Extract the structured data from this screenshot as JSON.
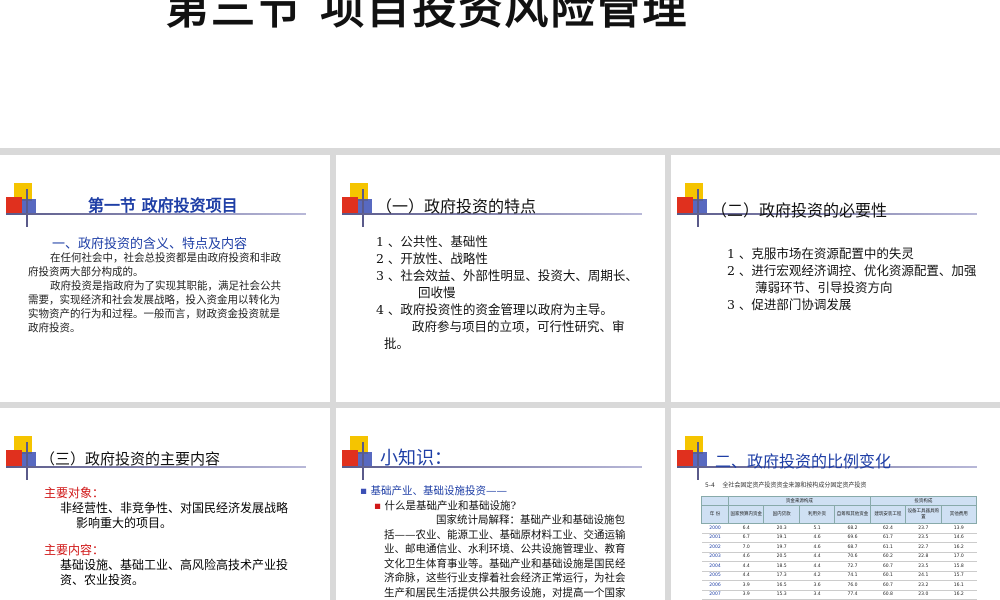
{
  "main_title": "第三节 项目投资风险管理",
  "slide1": {
    "title": "第一节 政府投资项目",
    "subtitle": "一、政府投资的含义、特点及内容",
    "para1": [
      "在任何社会中，社会总投资都是由政府投资和非政",
      "府投资两大部分构成的。"
    ],
    "para2": [
      "政府投资是指政府为了实现其职能，满足社会公共",
      "需要，实现经济和社会发展战略，投入资金用以转化为",
      "实物资产的行为和过程。一般而言，财政资金投资就是",
      "政府投资。"
    ]
  },
  "slide2": {
    "title": "（一）政府投资的特点",
    "items": [
      "1 、公共性、基础性",
      "2 、开放性、战略性",
      "3 、社会效益、外部性明显、投资大、周期长、",
      "回收慢",
      "4 、政府投资性的资金管理以政府为主导。",
      "政府参与项目的立项，可行性研究、审",
      "批。"
    ]
  },
  "slide3": {
    "title": "（二）政府投资的必要性",
    "items": [
      "1 、克服市场在资源配置中的失灵",
      "2 、进行宏观经济调控、优化资源配置、加强",
      "薄弱环节、引导投资方向",
      "3 、促进部门协调发展"
    ]
  },
  "slide4": {
    "title": "（三）政府投资的主要内容",
    "label1": "主要对象：",
    "text1": [
      "非经营性、非竞争性、对国民经济发展战略",
      "影响重大的项目。"
    ],
    "label2": "主要内容：",
    "text2": [
      "基础设施、基础工业、高风险高技术产业投",
      "资、农业投资。"
    ]
  },
  "slide5": {
    "title": "小知识：",
    "bullet1": "基础产业、基础设施投资——",
    "bullet2": "什么是基础产业和基础设施?",
    "lines": [
      "国家统计局解释：基础产业和基础设施包",
      "括——农业、能源工业、基础原材料工业、交通运输",
      "业、邮电通信业、水利环境、公共设施管理业、教育",
      "文化卫生体育事业等。基础产业和基础设施是国民经",
      "济命脉，这些行业支撑着社会经济正常运行，为社会",
      "生产和居民生活提供公共服务设施，对提高一个国家"
    ]
  },
  "slide6": {
    "title": "二、政府投资的比例变化",
    "table_caption": "5-4    全社会固定资产投资资金来源和按构成分固定资产投资",
    "group_headers": [
      "资金来源构成",
      "投资构成"
    ],
    "headers": [
      "年 份",
      "国家预算内资金",
      "国内贷款",
      "利用外资",
      "自筹和其他资金",
      "建筑安装工程",
      "设备工具器具购置",
      "其他费用"
    ],
    "rows": [
      [
        "2000",
        "6.4",
        "20.3",
        "5.1",
        "68.2",
        "62.4",
        "23.7",
        "13.9"
      ],
      [
        "2001",
        "6.7",
        "19.1",
        "4.6",
        "69.6",
        "61.7",
        "23.5",
        "14.6"
      ],
      [
        "2002",
        "7.0",
        "19.7",
        "4.6",
        "68.7",
        "61.1",
        "22.7",
        "16.2"
      ],
      [
        "2003",
        "4.6",
        "20.5",
        "4.4",
        "70.6",
        "60.2",
        "22.8",
        "17.0"
      ],
      [
        "2004",
        "4.4",
        "18.5",
        "4.4",
        "72.7",
        "60.7",
        "23.5",
        "15.8"
      ],
      [
        "2005",
        "4.4",
        "17.3",
        "4.2",
        "74.1",
        "60.1",
        "24.1",
        "15.7"
      ],
      [
        "2006",
        "3.9",
        "16.5",
        "3.6",
        "76.0",
        "60.7",
        "23.2",
        "16.1"
      ],
      [
        "2007",
        "3.9",
        "15.3",
        "3.4",
        "77.4",
        "60.8",
        "23.0",
        "16.2"
      ]
    ]
  },
  "colors": {
    "title_blue": "#1f3fa6",
    "label_red": "#d01818",
    "deco_yellow": "#f5c400",
    "deco_red": "#e0301e",
    "deco_blue": "#3b4fb5",
    "header_blue": "#cfe0f3"
  }
}
